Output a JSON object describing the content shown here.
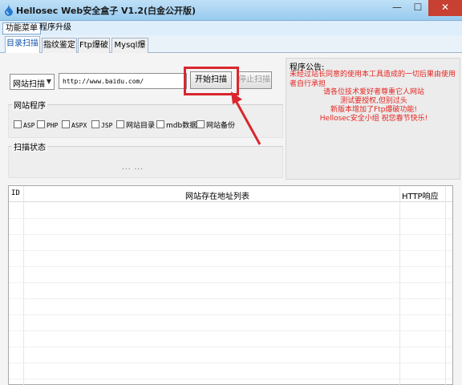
{
  "window": {
    "title": "Hellosec Web安全盒子 V1.2(白金公开版)",
    "close": "✕",
    "minimize": "—",
    "maximize": "☐"
  },
  "menu": {
    "items": [
      "功能菜单",
      "程序升级"
    ]
  },
  "tabs": [
    "目录扫描",
    "指纹鉴定",
    "Ftp爆破",
    "Mysql爆破"
  ],
  "scan": {
    "mode": "网站扫描",
    "url": "http://www.baidu.com/",
    "start_label": "开始扫描",
    "stop_label": "停止扫描"
  },
  "site_program": {
    "title": "网站程序",
    "options": [
      "ASP",
      "PHP",
      "ASPX",
      "JSP",
      "网站目录",
      "mdb数据库",
      "网站备份"
    ]
  },
  "scan_status": {
    "title": "扫描状态",
    "text": "... ..."
  },
  "notice": {
    "title": "程序公告:",
    "line1": "未经过站长同意的使用本工具造成的一切后果由使用者自行承担",
    "lines": [
      "请各位技术爱好者尊重它人网站",
      "测试要授权,但别过头",
      "新版本增加了Ftp爆破功能!",
      "Hellosec安全小组 祝您春节快乐!"
    ]
  },
  "list": {
    "col_id": "ID",
    "col_address": "网站存在地址列表",
    "col_http": "HTTP响应"
  },
  "colors": {
    "accent": "#d9272e",
    "notice_text": "#e42520",
    "titlebar": "#99cbef"
  }
}
